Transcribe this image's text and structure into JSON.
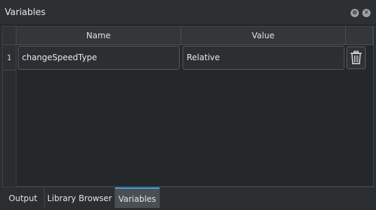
{
  "panel": {
    "title": "Variables",
    "controls": {
      "float_icon": "float-icon",
      "close_icon": "close-icon"
    }
  },
  "table": {
    "columns": [
      "Name",
      "Value"
    ],
    "rows": [
      {
        "index": "1",
        "name": "changeSpeedType",
        "value": "Relative",
        "action_icon": "trash-icon"
      }
    ]
  },
  "tabs": [
    {
      "label": "Output",
      "active": false
    },
    {
      "label": "Library Browser",
      "active": false
    },
    {
      "label": "Variables",
      "active": true
    }
  ],
  "colors": {
    "accent": "#3ea6ea",
    "background": "#24282b"
  }
}
